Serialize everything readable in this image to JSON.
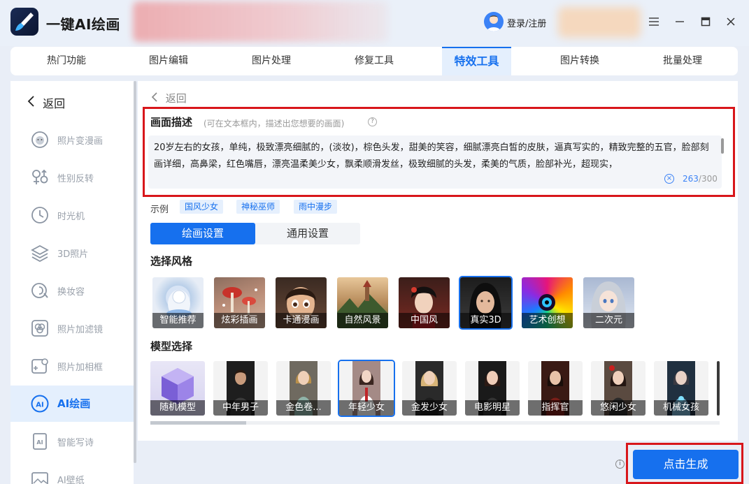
{
  "app": {
    "name": "一键AI绘画",
    "login_label": "登录/注册"
  },
  "top_nav": {
    "tabs": [
      {
        "label": "热门功能"
      },
      {
        "label": "图片编辑"
      },
      {
        "label": "图片处理"
      },
      {
        "label": "修复工具"
      },
      {
        "label": "特效工具",
        "active": true
      },
      {
        "label": "图片转换"
      },
      {
        "label": "批量处理"
      }
    ]
  },
  "sidebar": {
    "back_label": "返回",
    "items": [
      {
        "label": "照片变漫画",
        "icon": "face-cartoon-icon"
      },
      {
        "label": "性别反转",
        "icon": "gender-icon"
      },
      {
        "label": "时光机",
        "icon": "clock-icon"
      },
      {
        "label": "3D照片",
        "icon": "layers-icon"
      },
      {
        "label": "换妆容",
        "icon": "makeup-icon"
      },
      {
        "label": "照片加滤镜",
        "icon": "filter-icon"
      },
      {
        "label": "照片加相框",
        "icon": "frame-icon"
      },
      {
        "label": "AI绘画",
        "icon": "ai-paint-icon",
        "active": true
      },
      {
        "label": "智能写诗",
        "icon": "ai-poem-icon"
      },
      {
        "label": "AI壁纸",
        "icon": "ai-wallpaper-icon"
      }
    ]
  },
  "main": {
    "back_label": "返回",
    "description": {
      "title": "画面描述",
      "hint": "(可在文本框内，描述出您想要的画面)",
      "text": "20岁左右的女孩，单纯，极致漂亮细腻的，(淡妆)，棕色头发，甜美的笑容，细腻漂亮白皙的皮肤，逼真写实的，精致完整的五官，脸部刻画详细，高鼻梁，红色嘴唇，漂亮温柔美少女，飘柔顺滑发丝，极致细腻的头发，柔美的气质，脸部补光，超现实，",
      "count": "263",
      "max": "/300"
    },
    "examples": {
      "label": "示例",
      "chips": [
        "国风少女",
        "神秘巫师",
        "雨中漫步"
      ]
    },
    "settings_tabs": [
      {
        "label": "绘画设置",
        "active": true
      },
      {
        "label": "通用设置"
      }
    ],
    "style_section_title": "选择风格",
    "styles": [
      {
        "label": "智能推荐"
      },
      {
        "label": "炫彩插画"
      },
      {
        "label": "卡通漫画"
      },
      {
        "label": "自然风景"
      },
      {
        "label": "中国风"
      },
      {
        "label": "真实3D",
        "active": true
      },
      {
        "label": "艺术创想"
      },
      {
        "label": "二次元"
      }
    ],
    "model_section_title": "模型选择",
    "models": [
      {
        "label": "随机模型"
      },
      {
        "label": "中年男子"
      },
      {
        "label": "金色卷..."
      },
      {
        "label": "年轻少女",
        "active": true
      },
      {
        "label": "金发少女"
      },
      {
        "label": "电影明星"
      },
      {
        "label": "指挥官"
      },
      {
        "label": "悠闲少女"
      },
      {
        "label": "机械女孩"
      }
    ],
    "model_scroll_position": 0.17
  },
  "footer": {
    "generate_label": "点击生成"
  },
  "colors": {
    "accent": "#1670ee",
    "highlight_box": "#d8161b"
  }
}
